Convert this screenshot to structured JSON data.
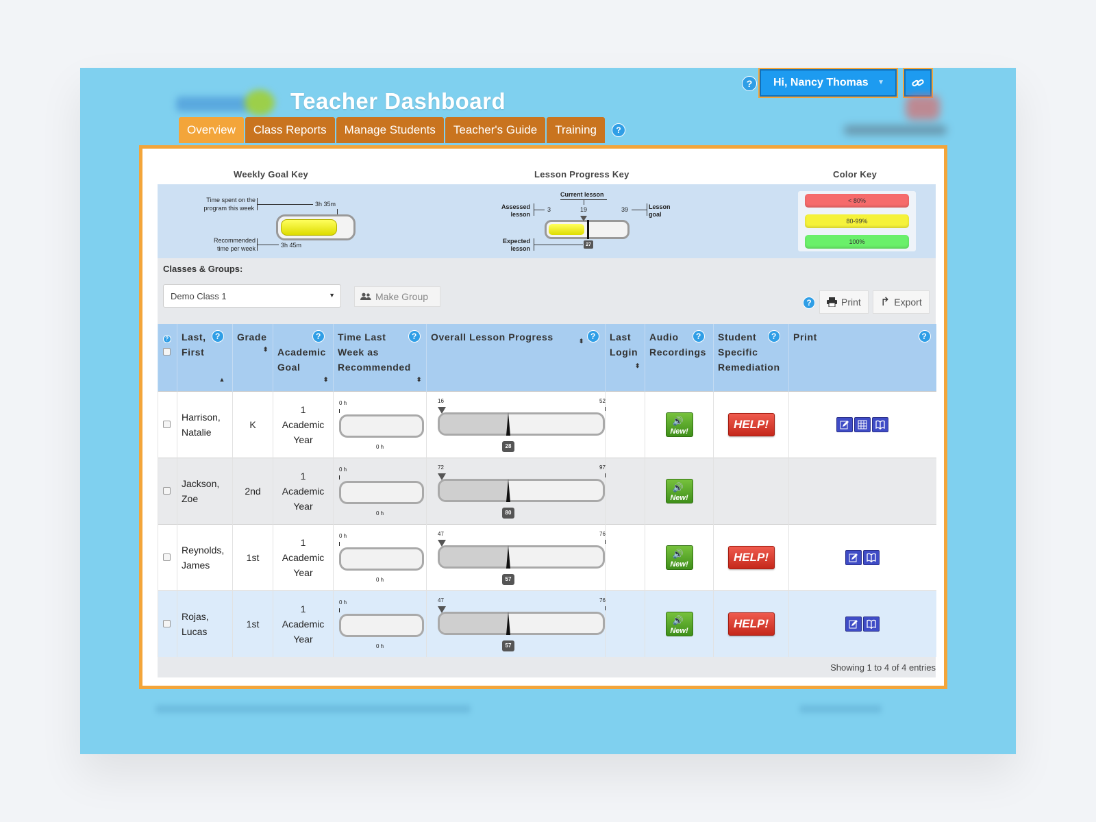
{
  "header": {
    "title": "Teacher Dashboard",
    "user_greeting": "Hi, Nancy Thomas",
    "help_glyph": "?"
  },
  "tabs": [
    {
      "label": "Overview",
      "active": true
    },
    {
      "label": "Class Reports",
      "active": false
    },
    {
      "label": "Manage Students",
      "active": false
    },
    {
      "label": "Teacher's Guide",
      "active": false
    },
    {
      "label": "Training",
      "active": false
    }
  ],
  "keys": {
    "weekly_goal": {
      "title": "Weekly Goal Key",
      "time_spent_label_1": "Time spent on the",
      "time_spent_label_2": "program this week",
      "time_spent_value": "3h 35m",
      "recommended_label_1": "Recommended",
      "recommended_label_2": "time per week",
      "recommended_value": "3h 45m"
    },
    "lesson_progress": {
      "title": "Lesson Progress Key",
      "current_lesson_label": "Current lesson",
      "assessed_label_1": "Assessed",
      "assessed_label_2": "lesson",
      "assessed_value": "3",
      "current_value": "19",
      "goal_value": "39",
      "goal_label_1": "Lesson",
      "goal_label_2": "goal",
      "expected_label_1": "Expected",
      "expected_label_2": "lesson",
      "expected_value": "27"
    },
    "color": {
      "title": "Color Key",
      "bands": [
        {
          "label": "< 80%",
          "color": "#f66b6b"
        },
        {
          "label": "80-99%",
          "color": "#f5f23a"
        },
        {
          "label": "100%",
          "color": "#6af06a"
        }
      ]
    }
  },
  "classes": {
    "label": "Classes & Groups:",
    "selected": "Demo Class 1",
    "make_group": "Make Group",
    "print": "Print",
    "export": "Export"
  },
  "table": {
    "headers": {
      "name": "Last, First",
      "grade": "Grade",
      "goal": "Academic Goal",
      "time": "Time Last Week as Recommended",
      "progress": "Overall Lesson Progress",
      "login": "Last Login",
      "audio": "Audio Recordings",
      "remediation": "Student Specific Remediation",
      "print": "Print"
    },
    "rows": [
      {
        "last": "Harrison,",
        "first": "Natalie",
        "grade": "K",
        "goal_1": "1",
        "goal_2": "Academic",
        "goal_3": "Year",
        "time_top": "0 h",
        "time_bottom": "0 h",
        "assessed": "16",
        "goal": "52",
        "current_fraction": 0.42,
        "expected": "28",
        "audio_new": "New!",
        "remediation": "HELP!",
        "print_icons": [
          "edit-icon",
          "grid-icon",
          "book-icon"
        ]
      },
      {
        "last": "Jackson,",
        "first": "Zoe",
        "grade": "2nd",
        "goal_1": "1",
        "goal_2": "Academic",
        "goal_3": "Year",
        "time_top": "0 h",
        "time_bottom": "0 h",
        "assessed": "72",
        "goal": "97",
        "current_fraction": 0.42,
        "expected": "80",
        "audio_new": "New!",
        "remediation": "",
        "print_icons": []
      },
      {
        "last": "Reynolds,",
        "first": "James",
        "grade": "1st",
        "goal_1": "1",
        "goal_2": "Academic",
        "goal_3": "Year",
        "time_top": "0 h",
        "time_bottom": "0 h",
        "assessed": "47",
        "goal": "76",
        "current_fraction": 0.42,
        "expected": "57",
        "audio_new": "New!",
        "remediation": "HELP!",
        "print_icons": [
          "edit-icon",
          "book-icon"
        ]
      },
      {
        "last": "Rojas,",
        "first": "Lucas",
        "grade": "1st",
        "goal_1": "1",
        "goal_2": "Academic",
        "goal_3": "Year",
        "time_top": "0 h",
        "time_bottom": "0 h",
        "assessed": "47",
        "goal": "76",
        "current_fraction": 0.42,
        "expected": "57",
        "audio_new": "New!",
        "remediation": "HELP!",
        "print_icons": [
          "edit-icon",
          "book-icon"
        ]
      }
    ],
    "footer": "Showing 1 to 4 of 4 entries"
  }
}
